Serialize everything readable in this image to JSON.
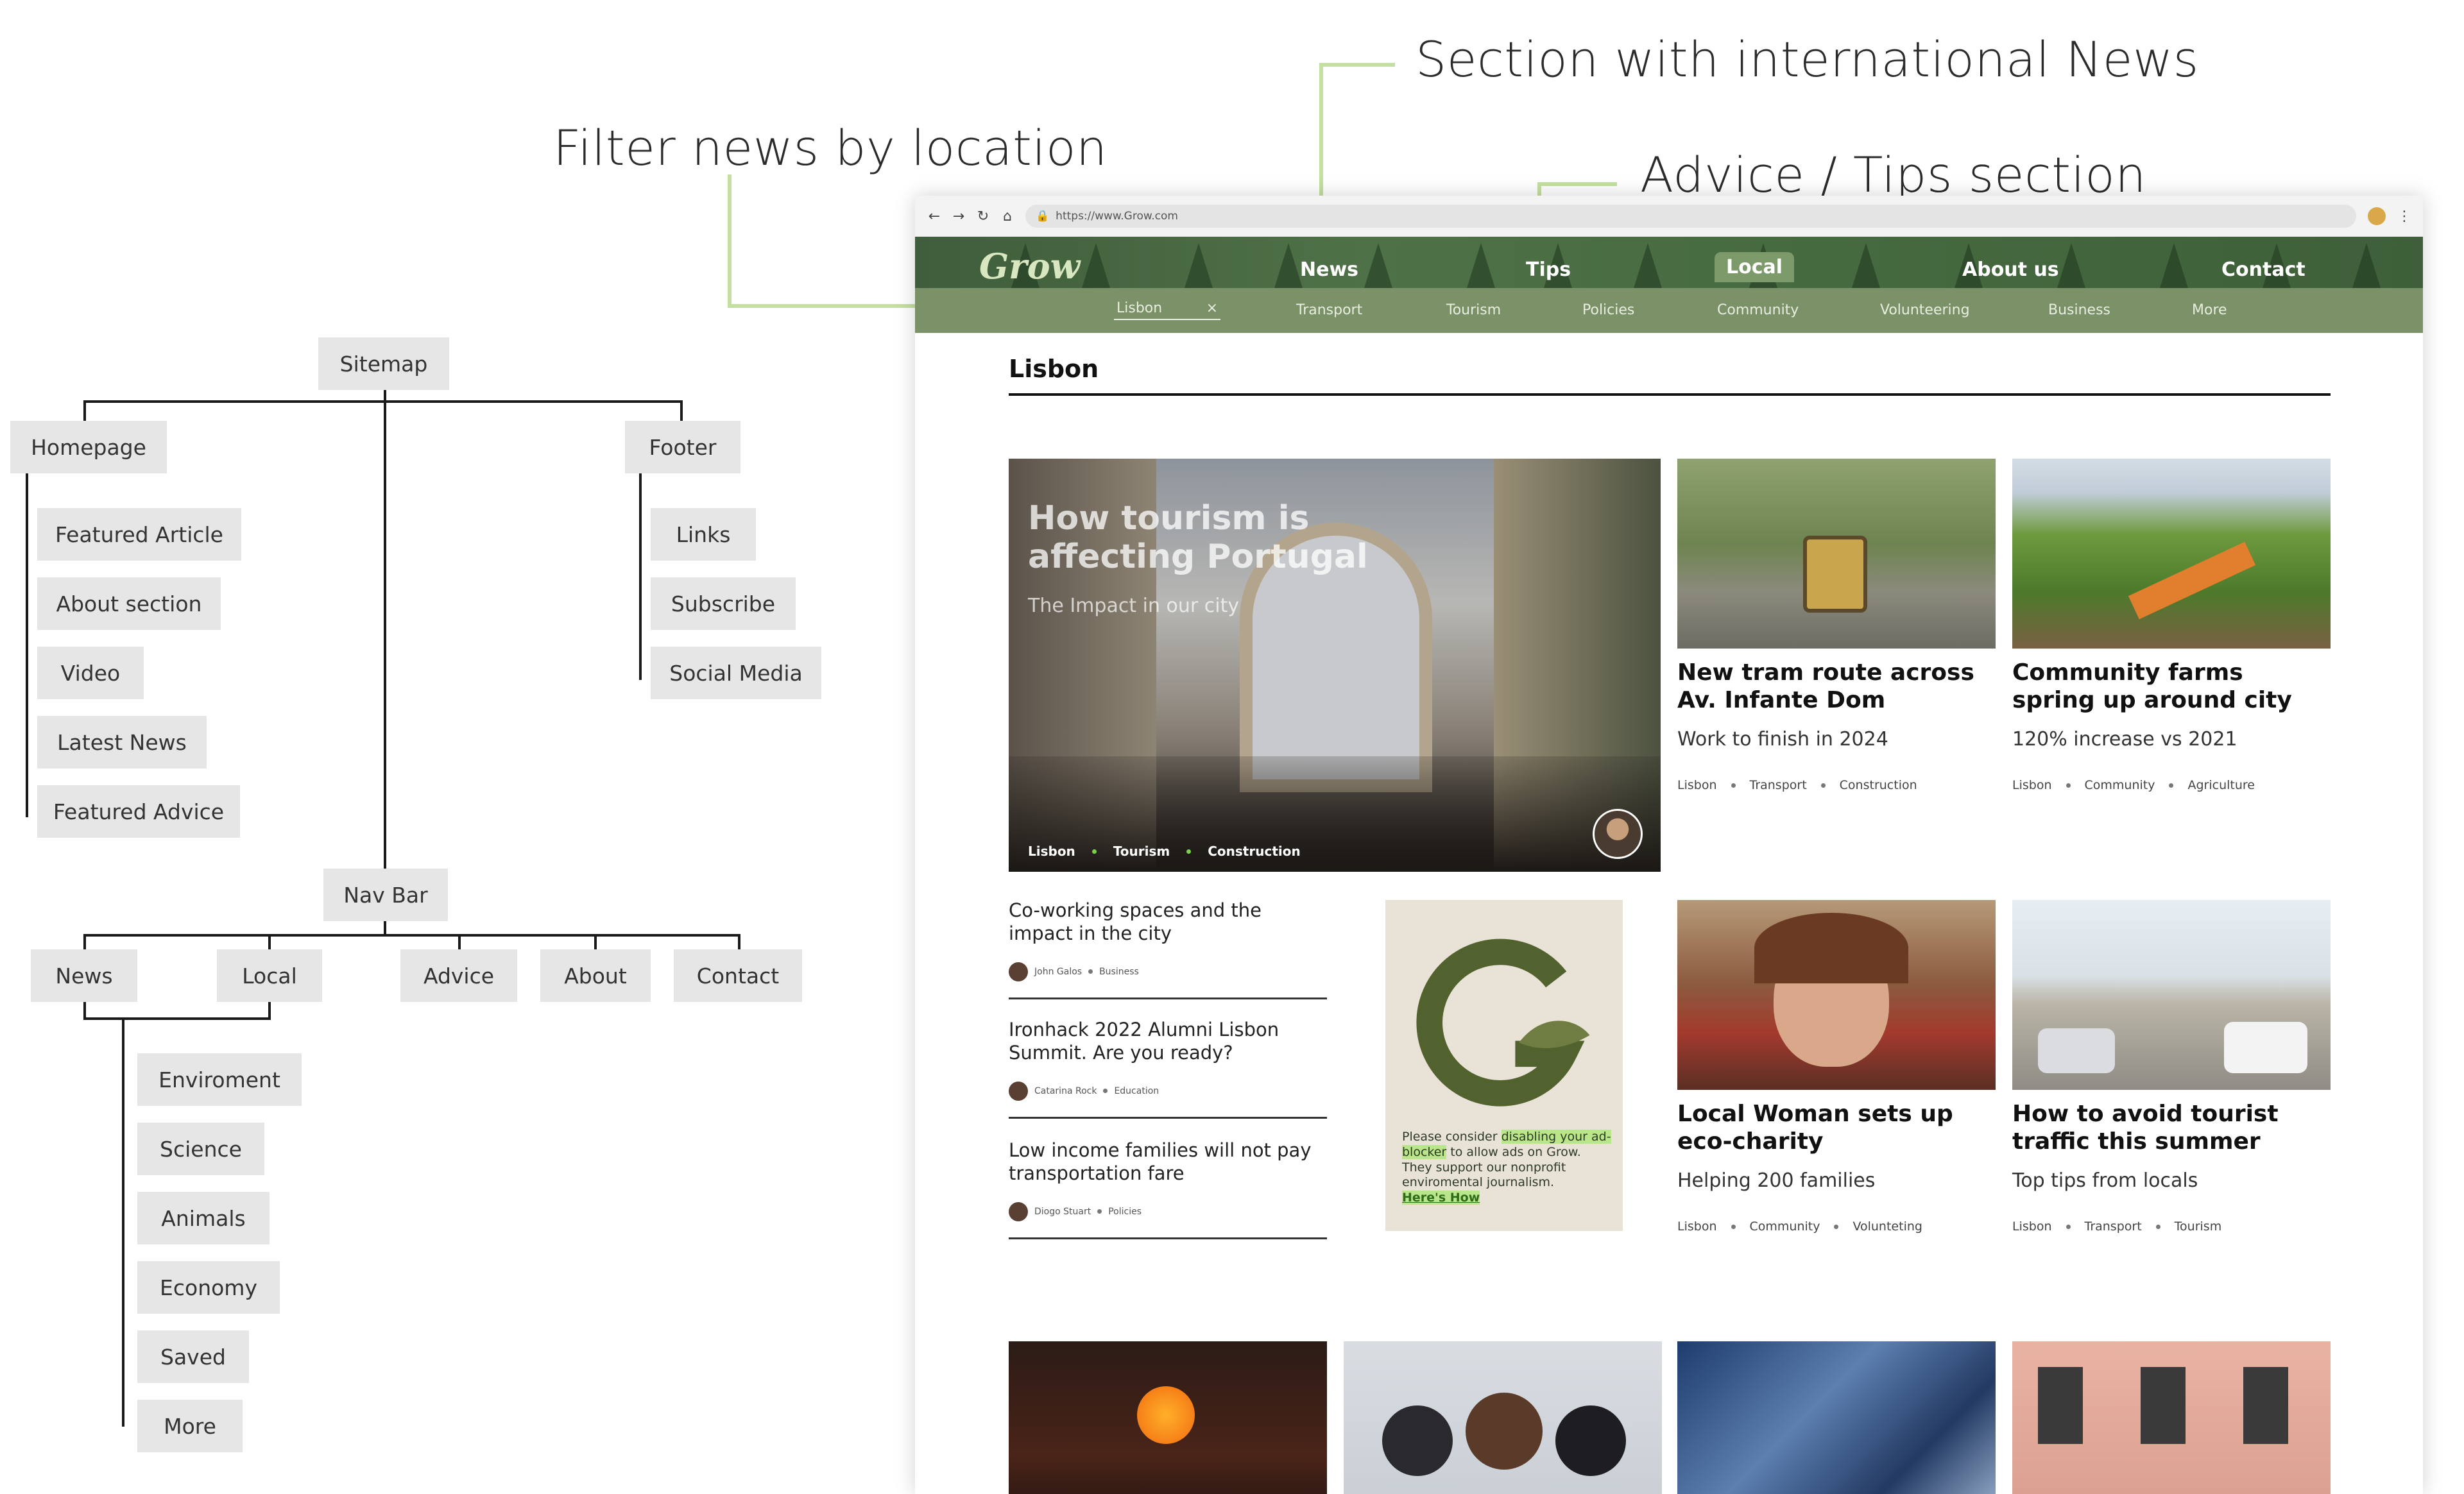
{
  "callouts": {
    "international": "Section with international News",
    "filter": "Filter news by location",
    "advice": "Advice / Tips section"
  },
  "sitemap": {
    "root": "Sitemap",
    "homepage": "Homepage",
    "footer": "Footer",
    "homepage_children": [
      "Featured Article",
      "About section",
      "Video",
      "Latest News",
      "Featured Advice"
    ],
    "footer_children": [
      "Links",
      "Subscribe",
      "Social Media"
    ],
    "navbar": "Nav Bar",
    "navbar_children": [
      "News",
      "Local",
      "Advice",
      "About",
      "Contact"
    ],
    "local_children": [
      "Enviroment",
      "Science",
      "Animals",
      "Economy",
      "Saved",
      "More"
    ]
  },
  "browser": {
    "url": "https://www.Grow.com",
    "logo": "Grow",
    "nav": [
      "News",
      "Tips",
      "Local",
      "About us",
      "Contact"
    ],
    "active_nav": "Local",
    "filter_value": "Lisbon",
    "filter_clear": "×",
    "subnav": [
      "Transport",
      "Tourism",
      "Policies",
      "Community",
      "Volunteering",
      "Business",
      "More"
    ],
    "section_title": "Lisbon",
    "hero": {
      "title": "How tourism is affecting Portugal",
      "subtitle": "The Impact in our city",
      "tags": [
        "Lisbon",
        "Tourism",
        "Construction"
      ]
    },
    "cards_top": [
      {
        "title": "New tram route across Av. Infante Dom",
        "sub": "Work to finish in 2024",
        "tags": [
          "Lisbon",
          "Transport",
          "Construction"
        ]
      },
      {
        "title": "Community farms spring up around city",
        "sub": "120% increase vs 2021",
        "tags": [
          "Lisbon",
          "Community",
          "Agriculture"
        ]
      }
    ],
    "list": [
      {
        "title": "Co-working spaces and the impact in the city",
        "author": "John Galos",
        "tag": "Business"
      },
      {
        "title": "Ironhack 2022 Alumni Lisbon Summit. Are you ready?",
        "author": "Catarina Rock",
        "tag": "Education"
      },
      {
        "title": "Low income families will not pay transportation fare",
        "author": "Diogo Stuart",
        "tag": "Policies"
      }
    ],
    "ad": {
      "t1": "Please consider ",
      "t2": "disabling your ad-blocker",
      "t3": " to allow ads on Grow. They  support our nonprofit enviromental journalism.",
      "link": "Here's How"
    },
    "cards_mid": [
      {
        "title": "Local Woman sets up eco-charity",
        "sub": "Helping 200 families",
        "tags": [
          "Lisbon",
          "Community",
          "Volunteting"
        ]
      },
      {
        "title": "How to avoid tourist traffic this summer",
        "sub": "Top tips from locals",
        "tags": [
          "Lisbon",
          "Transport",
          "Tourism"
        ]
      }
    ]
  }
}
